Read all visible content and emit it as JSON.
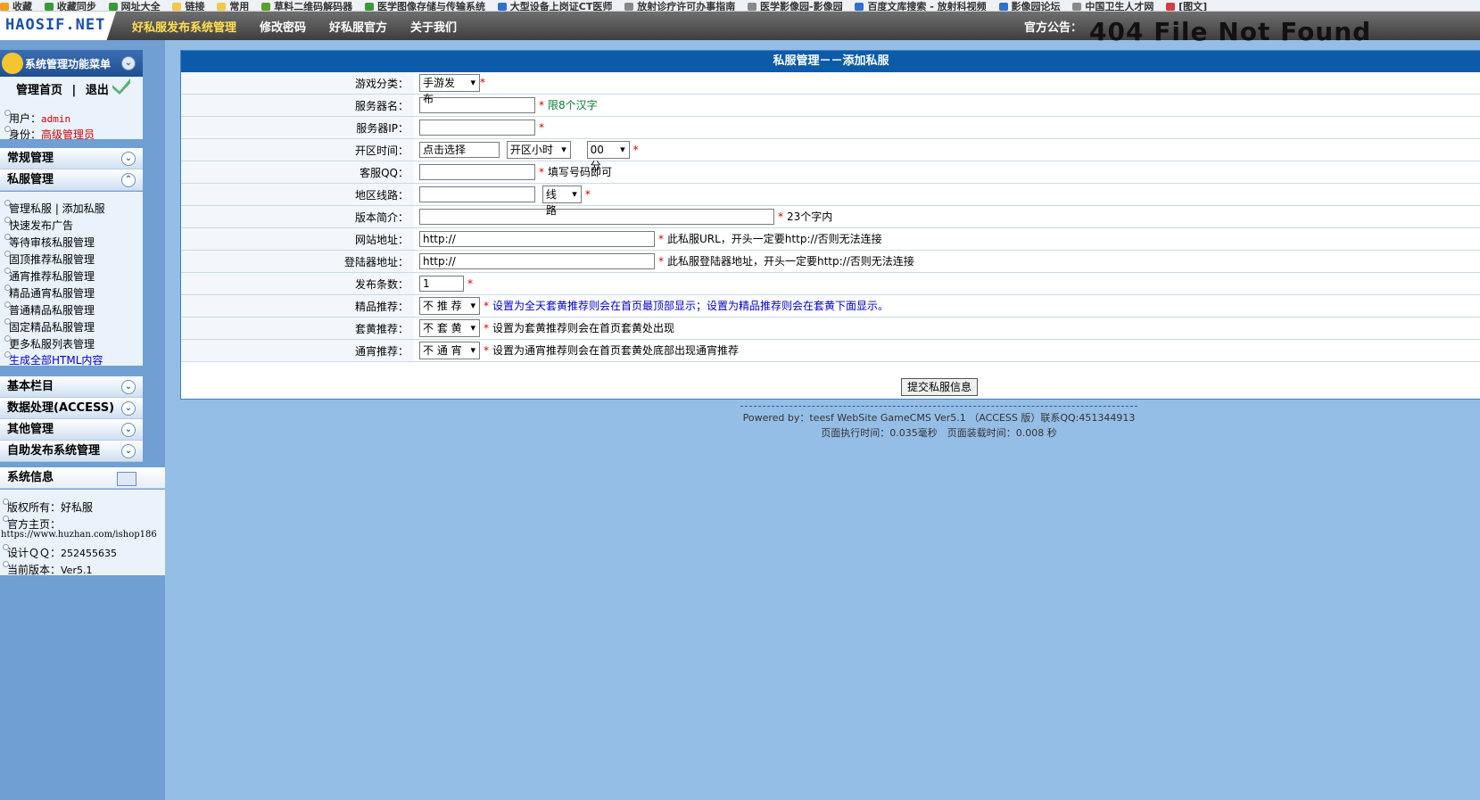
{
  "bookmarks": [
    "收藏",
    "收藏同步",
    "网址大全",
    "链接",
    "常用",
    "草料二维码解码器",
    "医学图像存储与传输系统",
    "大型设备上岗证CT医师",
    "放射诊疗许可办事指南",
    "医学影像园-影像园",
    "百度文库搜索 - 放射科视频",
    "影像园论坛",
    "中国卫生人才网",
    "[图文]"
  ],
  "header": {
    "logo": "HAOSIF.NET",
    "nav": [
      "好私服发布系统管理",
      "修改密码",
      "好私服官方",
      "关于我们"
    ],
    "notice_label": "官方公告：",
    "notice_text": "404 File Not Found"
  },
  "sidebar": {
    "menu_title": "系统管理功能菜单",
    "home": "管理首页",
    "sep": "|",
    "logout": "退出",
    "user_label": "用户：",
    "user_value": "admin",
    "role_label": "身份：",
    "role_value": "高级管理员",
    "section_common": "常规管理",
    "section_private": "私服管理",
    "private_items": [
      "管理私服 | 添加私服",
      "快速发布广告",
      "等待审核私服管理",
      "固顶推荐私服管理",
      "通宵推荐私服管理",
      "精品通宵私服管理",
      "普通精品私服管理",
      "固定精品私服管理",
      "更多私服列表管理",
      "生成全部HTML内容"
    ],
    "section_basic": "基本栏目",
    "section_data": "数据处理(ACCESS)",
    "section_other": "其他管理",
    "section_self": "自助发布系统管理",
    "sysinfo_title": "系统信息",
    "copyright_label": "版权所有：",
    "copyright_value": "好私服",
    "homepage_label": "官方主页：",
    "homepage_value": "https://www.huzhan.com/ishop186",
    "qq_label": "设计ＱＱ：",
    "qq_value": "252455635",
    "version_label": "当前版本：",
    "version_value": "Ver5.1"
  },
  "form": {
    "title": "私服管理－－添加私服",
    "game_category_label": "游戏分类：",
    "game_category_value": "手游发布",
    "server_name_label": "服务器名：",
    "server_name_hint": "限8个汉字",
    "server_ip_label": "服务器IP：",
    "open_time_label": "开区时间：",
    "open_time_placeholder": "点击选择",
    "open_hour_value": "开区小时",
    "open_min_value": "00分",
    "qq_label": "客服QQ：",
    "qq_hint": "填写号码即可",
    "region_label": "地区线路：",
    "region_value": "线路",
    "intro_label": "版本简介：",
    "intro_hint": "23个字内",
    "url_label": "网站地址：",
    "url_value": "http://",
    "url_hint": "此私服URL，开头一定要http://否则无法连接",
    "login_label": "登陆器地址：",
    "login_value": "http://",
    "login_hint": "此私服登陆器地址，开头一定要http://否则无法连接",
    "count_label": "发布条数：",
    "count_value": "1",
    "fine_label": "精品推荐：",
    "fine_value": "不 推 荐",
    "fine_hint": "设置为全天套黄推荐则会在首页最顶部显示；设置为精品推荐则会在套黄下面显示。",
    "yellow_label": "套黄推荐：",
    "yellow_value": "不 套 黄",
    "yellow_hint": "设置为套黄推荐则会在首页套黄处出现",
    "night_label": "通宵推荐：",
    "night_value": "不 通 宵",
    "night_hint": "设置为通宵推荐则会在首页套黄处底部出现通宵推荐",
    "submit": "提交私服信息",
    "star": "*"
  },
  "footer": {
    "powered": "Powered by：teesf WebSite GameCMS Ver5.1 （ACCESS 版）联系QQ:451344913",
    "timing": "页面执行时间：0.035毫秒　页面装载时间：0.008 秒"
  }
}
